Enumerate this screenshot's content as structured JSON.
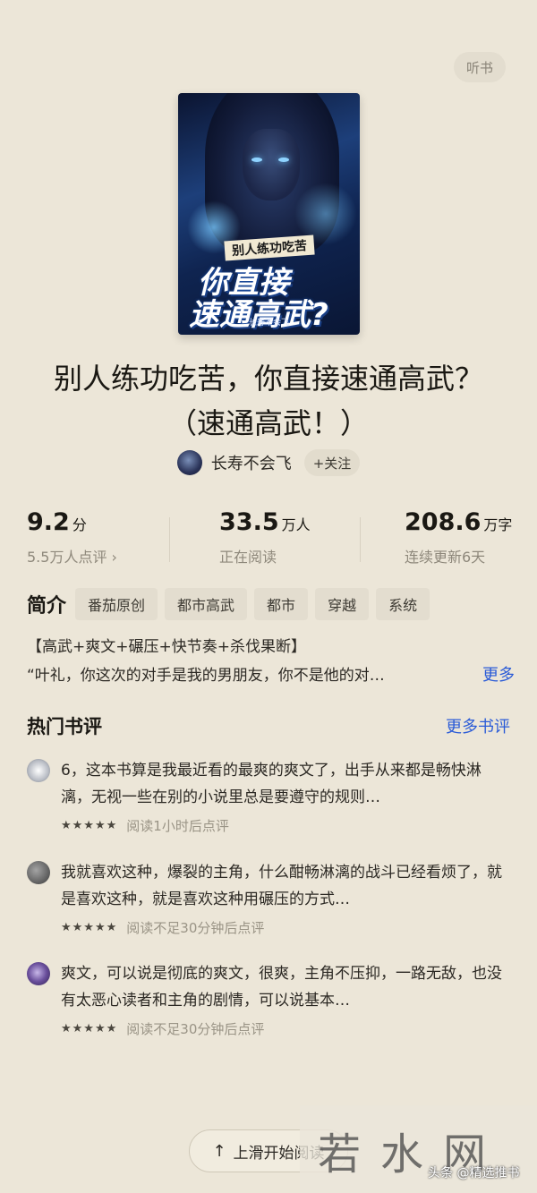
{
  "header": {
    "listen_label": "听书"
  },
  "book": {
    "cover": {
      "subtitle": "别人练功吃苦",
      "title_line1": "你直接",
      "title_line2": "速通高武?",
      "author": "长寿不会飞"
    },
    "title": "别人练功吃苦，你直接速通高武？（速通高武！）",
    "author_name": "长寿不会飞",
    "follow_label": "+关注"
  },
  "stats": [
    {
      "value": "9.2",
      "unit": "分",
      "label": "5.5万人点评 ›"
    },
    {
      "value": "33.5",
      "unit": "万人",
      "label": "正在阅读"
    },
    {
      "value": "208.6",
      "unit": "万字",
      "label": "连续更新6天"
    }
  ],
  "intro": {
    "label": "简介",
    "tags": [
      "番茄原创",
      "都市高武",
      "都市",
      "穿越",
      "系统"
    ],
    "keywords": "【高武+爽文+碾压+快节奏+杀伐果断】",
    "quote": "“叶礼，你这次的对手是我的男朋友，你不是他的对…",
    "more_label": "更多"
  },
  "reviews": {
    "title": "热门书评",
    "more_label": "更多书评",
    "items": [
      {
        "text": "6，这本书算是我最近看的最爽的爽文了，出手从来都是畅快淋漓，无视一些在别的小说里总是要遵守的规则…",
        "stars": "★★★★★",
        "time": "阅读1小时后点评"
      },
      {
        "text": "我就喜欢这种，爆裂的主角，什么酣畅淋漓的战斗已经看烦了，就是喜欢这种，就是喜欢这种用碾压的方式…",
        "stars": "★★★★★",
        "time": "阅读不足30分钟后点评"
      },
      {
        "text": "爽文，可以说是彻底的爽文，很爽，主角不压抑，一路无敌，也没有太恶心读者和主角的剧情，可以说基本…",
        "stars": "★★★★★",
        "time": "阅读不足30分钟后点评"
      }
    ]
  },
  "footer": {
    "swipe_label": "上滑开始阅读",
    "arrow_icon": "↑"
  },
  "watermark": {
    "big_text": "若水网",
    "small_text": "头条 @精选推书"
  }
}
